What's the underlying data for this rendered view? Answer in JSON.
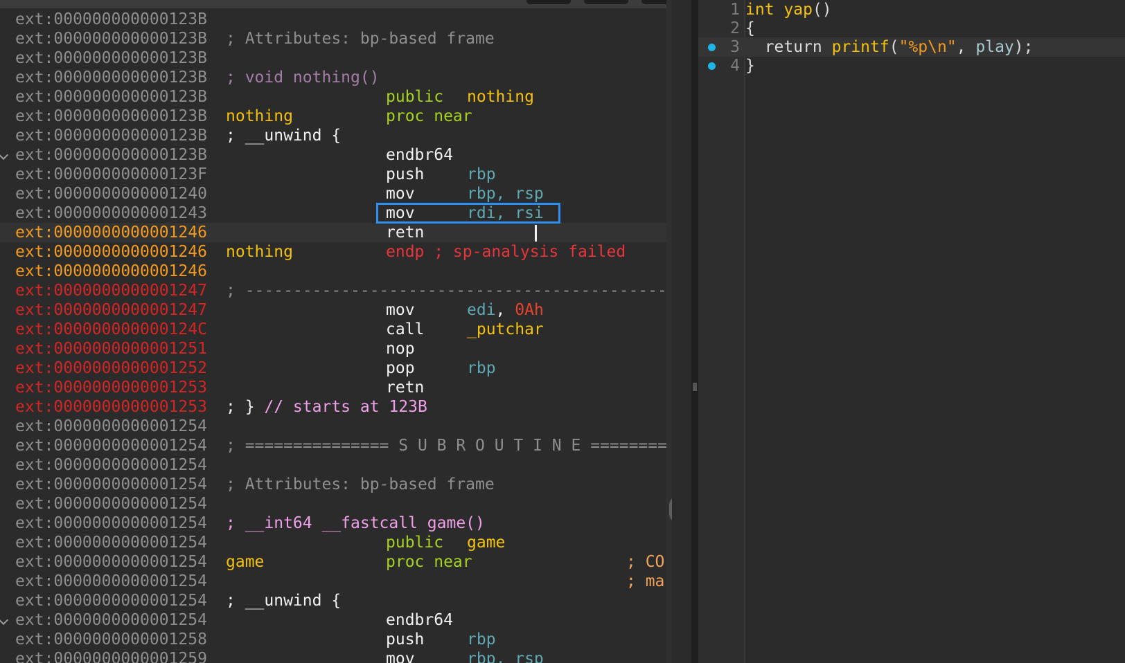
{
  "disassembly": {
    "lines": [
      {
        "addr": "ext:000000000000123B",
        "addr_color": "grey",
        "label": "",
        "instr": "",
        "ops": "",
        "comment": "",
        "label_class": ""
      },
      {
        "addr": "ext:000000000000123B",
        "addr_color": "grey",
        "label": "; Attributes: bp-based frame",
        "label_class": "comment"
      },
      {
        "addr": "ext:000000000000123B",
        "addr_color": "grey",
        "label": "",
        "label_class": ""
      },
      {
        "addr": "ext:000000000000123B",
        "addr_color": "grey",
        "label": "; void nothing()",
        "label_class": "proto"
      },
      {
        "addr": "ext:000000000000123B",
        "addr_color": "grey",
        "label": "",
        "instr": "public",
        "instr_class": "green",
        "ops": "nothing",
        "ops_class": "label"
      },
      {
        "addr": "ext:000000000000123B",
        "addr_color": "grey",
        "label": "nothing",
        "label_class": "label",
        "instr": "proc near",
        "instr_class": "green"
      },
      {
        "addr": "ext:000000000000123B",
        "addr_color": "grey",
        "label": "; __unwind {",
        "label_class": "white"
      },
      {
        "addr": "ext:000000000000123B",
        "addr_color": "grey",
        "fold": true,
        "instr": "endbr64",
        "instr_class": "white"
      },
      {
        "addr": "ext:000000000000123F",
        "addr_color": "grey",
        "instr": "push",
        "instr_class": "white",
        "ops": "rbp",
        "ops_class": "reg"
      },
      {
        "addr": "ext:0000000000001240",
        "addr_color": "grey",
        "instr": "mov",
        "instr_class": "white",
        "ops": "rbp, rsp",
        "ops_class": "reg"
      },
      {
        "addr": "ext:0000000000001243",
        "addr_color": "grey",
        "instr": "mov",
        "instr_class": "white",
        "ops": "rdi, rsi",
        "ops_class": "reg",
        "selected": true
      },
      {
        "addr": "ext:0000000000001246",
        "addr_color": "orange",
        "instr": "retn",
        "instr_class": "white",
        "current": true
      },
      {
        "addr": "ext:0000000000001246",
        "addr_color": "orange",
        "label": "nothing",
        "label_class": "label",
        "instr": "endp ; sp-analysis failed",
        "instr_class": "red"
      },
      {
        "addr": "ext:0000000000001246",
        "addr_color": "orange"
      },
      {
        "addr": "ext:0000000000001247",
        "addr_color": "red",
        "label": "; ---------------------------------------------------------------------------",
        "label_class": "comment"
      },
      {
        "addr": "ext:0000000000001247",
        "addr_color": "red",
        "instr": "mov",
        "instr_class": "white",
        "ops_parts": [
          {
            "t": "edi",
            "c": "reg"
          },
          {
            "t": ", ",
            "c": "white"
          },
          {
            "t": "0Ah",
            "c": "num"
          }
        ]
      },
      {
        "addr": "ext:000000000000124C",
        "addr_color": "red",
        "instr": "call",
        "instr_class": "white",
        "ops": "_putchar",
        "ops_class": "label"
      },
      {
        "addr": "ext:0000000000001251",
        "addr_color": "red",
        "instr": "nop",
        "instr_class": "white"
      },
      {
        "addr": "ext:0000000000001252",
        "addr_color": "red",
        "instr": "pop",
        "instr_class": "white",
        "ops": "rbp",
        "ops_class": "reg"
      },
      {
        "addr": "ext:0000000000001253",
        "addr_color": "red",
        "instr": "retn",
        "instr_class": "white"
      },
      {
        "addr": "ext:0000000000001253",
        "addr_color": "red",
        "label_parts": [
          {
            "t": "; } ",
            "c": "white"
          },
          {
            "t": "// starts at 123B",
            "c": "pink"
          }
        ]
      },
      {
        "addr": "ext:0000000000001254",
        "addr_color": "grey"
      },
      {
        "addr": "ext:0000000000001254",
        "addr_color": "grey",
        "label": "; =============== S U B R O U T I N E =======================================",
        "label_class": "comment"
      },
      {
        "addr": "ext:0000000000001254",
        "addr_color": "grey"
      },
      {
        "addr": "ext:0000000000001254",
        "addr_color": "grey",
        "label": "; Attributes: bp-based frame",
        "label_class": "comment"
      },
      {
        "addr": "ext:0000000000001254",
        "addr_color": "grey"
      },
      {
        "addr": "ext:0000000000001254",
        "addr_color": "grey",
        "label": "; __int64 __fastcall game()",
        "label_class": "pink"
      },
      {
        "addr": "ext:0000000000001254",
        "addr_color": "grey",
        "instr": "public",
        "instr_class": "green",
        "ops": "game",
        "ops_class": "label"
      },
      {
        "addr": "ext:0000000000001254",
        "addr_color": "grey",
        "label": "game",
        "label_class": "label",
        "instr": "proc near",
        "instr_class": "green",
        "rcomment": "; CO",
        "rcomment_class": "orange"
      },
      {
        "addr": "ext:0000000000001254",
        "addr_color": "grey",
        "rcomment": "; ma",
        "rcomment_class": "orange"
      },
      {
        "addr": "ext:0000000000001254",
        "addr_color": "grey",
        "label": "; __unwind {",
        "label_class": "white"
      },
      {
        "addr": "ext:0000000000001254",
        "addr_color": "grey",
        "fold": true,
        "instr": "endbr64",
        "instr_class": "white"
      },
      {
        "addr": "ext:0000000000001258",
        "addr_color": "grey",
        "instr": "push",
        "instr_class": "white",
        "ops": "rbp",
        "ops_class": "reg"
      },
      {
        "addr": "ext:0000000000001259",
        "addr_color": "grey",
        "instr": "mov",
        "instr_class": "white",
        "ops": "rbp, rsp",
        "ops_class": "reg"
      }
    ]
  },
  "pseudocode": {
    "lines": [
      {
        "num": "1",
        "parts": [
          {
            "t": "int ",
            "c": "type"
          },
          {
            "t": "yap",
            "c": "fn"
          },
          {
            "t": "()",
            "c": "paren"
          }
        ]
      },
      {
        "num": "2",
        "parts": [
          {
            "t": "{",
            "c": "paren"
          }
        ]
      },
      {
        "num": "3",
        "dot": true,
        "active": true,
        "parts": [
          {
            "t": "  return ",
            "c": "kw"
          },
          {
            "t": "printf",
            "c": "fn"
          },
          {
            "t": "(",
            "c": "paren"
          },
          {
            "t": "\"%p\\n\"",
            "c": "str"
          },
          {
            "t": ", ",
            "c": "paren"
          },
          {
            "t": "play",
            "c": "var"
          },
          {
            "t": ");",
            "c": "paren"
          }
        ]
      },
      {
        "num": "4",
        "dot": true,
        "parts": [
          {
            "t": "}",
            "c": "paren"
          }
        ]
      }
    ]
  }
}
